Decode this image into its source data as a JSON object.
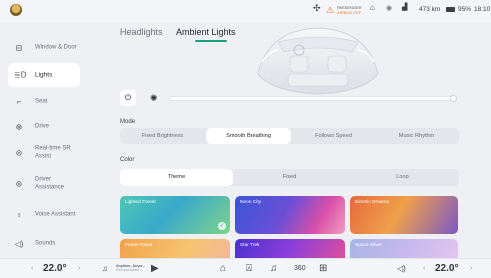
{
  "status_bar": {
    "avatar_icon": "user-avatar",
    "fan_icon": "fan-icon",
    "airbag_line1": "PASSENGER",
    "airbag_line2": "AIRBAG OFF",
    "range": "473 km",
    "battery_pct": "95%",
    "time": "18:10"
  },
  "sidebar": {
    "items": [
      {
        "label": "Window & Door",
        "icon": "window-icon"
      },
      {
        "label": "Lights",
        "icon": "lights-icon",
        "active": true
      },
      {
        "label": "Seat",
        "icon": "seat-icon"
      },
      {
        "label": "Drive",
        "icon": "steering-wheel-icon"
      },
      {
        "label": "Real-time SR Assist",
        "icon": "sr-assist-icon"
      },
      {
        "label": "Driver Assistance",
        "icon": "driver-assistance-icon"
      },
      {
        "label": "Voice Assistant",
        "icon": "voice-icon"
      },
      {
        "label": "Sounds",
        "icon": "speaker-icon"
      }
    ]
  },
  "tabs": [
    {
      "label": "Headlights"
    },
    {
      "label": "Ambient Lights",
      "active": true
    }
  ],
  "brightness": {
    "value_fraction": 1.0
  },
  "mode": {
    "label": "Mode",
    "options": [
      "Fixed Brightness",
      "Smooth Breathing",
      "Follows Speed",
      "Music Rhythm"
    ],
    "selected": "Smooth Breathing"
  },
  "color": {
    "label": "Color",
    "options": [
      "Theme",
      "Fixed",
      "Loop"
    ],
    "selected": "Theme"
  },
  "themes": [
    {
      "name": "Lighted Forest",
      "selected": true
    },
    {
      "name": "Neon City"
    },
    {
      "name": "Electric Dreams"
    },
    {
      "name": "Future Ruins"
    },
    {
      "name": "Star Trek"
    },
    {
      "name": "Space Silver"
    }
  ],
  "bottom_bar": {
    "temp_left": "22.0°",
    "temp_right": "22.0°",
    "music_title": "Anytime, Anyw...",
    "music_sub": "Second audio"
  },
  "accent_color": "#1b9e7a"
}
